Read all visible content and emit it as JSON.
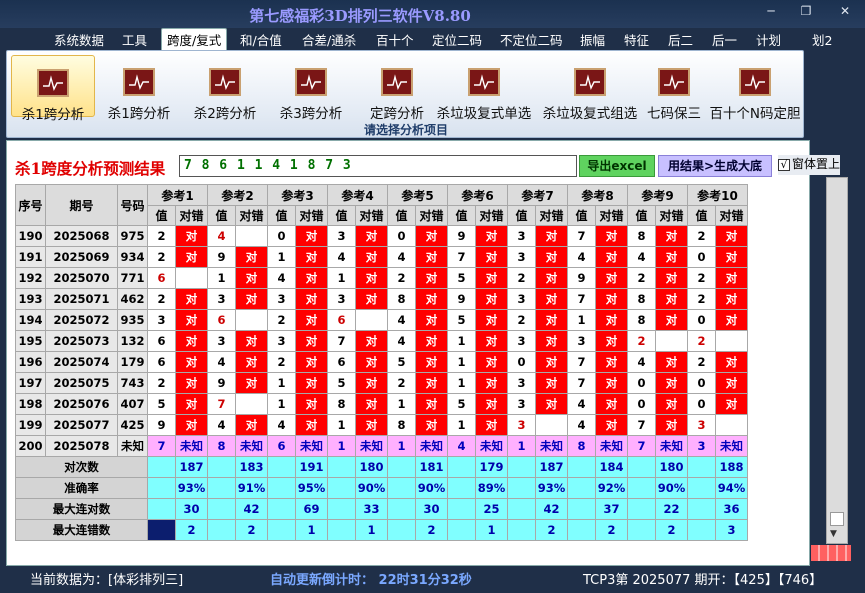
{
  "app_title": "第七感福彩3D排列三软件V8.80",
  "window_buttons": {
    "minimize": "─",
    "restore": "❐",
    "close": "✕"
  },
  "menu": [
    "系统数据",
    "工具",
    "跨度/复式",
    "和/合值",
    "合差/通杀",
    "百十个",
    "定位二码",
    "不定位二码",
    "振幅",
    "特征",
    "后二",
    "后一",
    "计划",
    "划2"
  ],
  "ribbon": {
    "items": [
      "杀1跨分析",
      "杀1跨分析",
      "杀2跨分析",
      "杀3跨分析",
      "定跨分析",
      "杀垃圾复式单选",
      "杀垃圾复式组选",
      "七码保三",
      "百十个N码定胆"
    ],
    "group_caption": "请选择分析项目"
  },
  "result": {
    "title": "杀1跨度分析预测结果",
    "digits": "7 8 6 1 1 4 1 8 7 3",
    "export_button": "导出excel",
    "generate_button": "用结果>生成大底",
    "topmost_check": "√",
    "topmost_label": "窗体置上"
  },
  "table": {
    "col_headers": [
      "序号",
      "期号",
      "号码"
    ],
    "refs": [
      "参考1",
      "参考2",
      "参考3",
      "参考4",
      "参考5",
      "参考6",
      "参考7",
      "参考8",
      "参考9",
      "参考10"
    ],
    "sub_headers": [
      "值",
      "对错"
    ],
    "rows": [
      {
        "seq": "190",
        "issue": "2025068",
        "num": "975",
        "vals": [
          "2",
          "4",
          "0",
          "3",
          "0",
          "9",
          "3",
          "7",
          "8",
          "2"
        ],
        "marks": [
          "对",
          "",
          "对",
          "对",
          "对",
          "对",
          "对",
          "对",
          "对",
          "对"
        ]
      },
      {
        "seq": "191",
        "issue": "2025069",
        "num": "934",
        "vals": [
          "2",
          "9",
          "1",
          "4",
          "4",
          "7",
          "3",
          "4",
          "4",
          "0"
        ],
        "marks": [
          "对",
          "对",
          "对",
          "对",
          "对",
          "对",
          "对",
          "对",
          "对",
          "对"
        ]
      },
      {
        "seq": "192",
        "issue": "2025070",
        "num": "771",
        "vals": [
          "6",
          "1",
          "4",
          "1",
          "2",
          "5",
          "2",
          "9",
          "2",
          "2"
        ],
        "marks": [
          "",
          "对",
          "对",
          "对",
          "对",
          "对",
          "对",
          "对",
          "对",
          "对"
        ]
      },
      {
        "seq": "193",
        "issue": "2025071",
        "num": "462",
        "vals": [
          "2",
          "3",
          "3",
          "3",
          "8",
          "9",
          "3",
          "7",
          "8",
          "2"
        ],
        "marks": [
          "对",
          "对",
          "对",
          "对",
          "对",
          "对",
          "对",
          "对",
          "对",
          "对"
        ]
      },
      {
        "seq": "194",
        "issue": "2025072",
        "num": "935",
        "vals": [
          "3",
          "6",
          "2",
          "6",
          "4",
          "5",
          "2",
          "1",
          "8",
          "0"
        ],
        "marks": [
          "对",
          "",
          "对",
          "",
          "对",
          "对",
          "对",
          "对",
          "对",
          "对"
        ]
      },
      {
        "seq": "195",
        "issue": "2025073",
        "num": "132",
        "vals": [
          "6",
          "3",
          "3",
          "7",
          "4",
          "1",
          "3",
          "3",
          "2",
          "2"
        ],
        "marks": [
          "对",
          "对",
          "对",
          "对",
          "对",
          "对",
          "对",
          "对",
          "",
          ""
        ]
      },
      {
        "seq": "196",
        "issue": "2025074",
        "num": "179",
        "vals": [
          "6",
          "4",
          "2",
          "6",
          "5",
          "1",
          "0",
          "7",
          "4",
          "2"
        ],
        "marks": [
          "对",
          "对",
          "对",
          "对",
          "对",
          "对",
          "对",
          "对",
          "对",
          "对"
        ]
      },
      {
        "seq": "197",
        "issue": "2025075",
        "num": "743",
        "vals": [
          "2",
          "9",
          "1",
          "5",
          "2",
          "1",
          "3",
          "7",
          "0",
          "0"
        ],
        "marks": [
          "对",
          "对",
          "对",
          "对",
          "对",
          "对",
          "对",
          "对",
          "对",
          "对"
        ]
      },
      {
        "seq": "198",
        "issue": "2025076",
        "num": "407",
        "vals": [
          "5",
          "7",
          "1",
          "8",
          "1",
          "5",
          "3",
          "4",
          "0",
          "0"
        ],
        "marks": [
          "对",
          "",
          "对",
          "对",
          "对",
          "对",
          "对",
          "对",
          "对",
          "对"
        ]
      },
      {
        "seq": "199",
        "issue": "2025077",
        "num": "425",
        "vals": [
          "9",
          "4",
          "4",
          "1",
          "8",
          "1",
          "3",
          "4",
          "7",
          "3"
        ],
        "marks": [
          "对",
          "对",
          "对",
          "对",
          "对",
          "对",
          "",
          "对",
          "对",
          ""
        ]
      },
      {
        "seq": "200",
        "issue": "2025078",
        "num": "未知",
        "vals": [
          "7",
          "8",
          "6",
          "1",
          "1",
          "4",
          "1",
          "8",
          "7",
          "3"
        ],
        "marks": [
          "未知",
          "未知",
          "未知",
          "未知",
          "未知",
          "未知",
          "未知",
          "未知",
          "未知",
          "未知"
        ]
      }
    ],
    "red_values": [
      [
        0,
        1
      ],
      [
        2,
        0
      ],
      [
        4,
        1
      ],
      [
        4,
        3
      ],
      [
        5,
        8
      ],
      [
        5,
        9
      ],
      [
        8,
        1
      ],
      [
        9,
        6
      ],
      [
        9,
        9
      ]
    ],
    "stats": [
      {
        "label": "对次数",
        "values": [
          "187",
          "183",
          "191",
          "180",
          "181",
          "179",
          "187",
          "184",
          "180",
          "188"
        ]
      },
      {
        "label": "准确率",
        "values": [
          "93%",
          "91%",
          "95%",
          "90%",
          "90%",
          "89%",
          "93%",
          "92%",
          "90%",
          "94%"
        ]
      },
      {
        "label": "最大连对数",
        "values": [
          "30",
          "42",
          "69",
          "33",
          "30",
          "25",
          "42",
          "37",
          "22",
          "36"
        ]
      },
      {
        "label": "最大连错数",
        "values": [
          "2",
          "2",
          "1",
          "1",
          "2",
          "1",
          "2",
          "2",
          "2",
          "3"
        ]
      }
    ]
  },
  "status": {
    "current_label": "当前数据为：[体彩排列三]",
    "countdown": "自动更新倒计时： 22时31分32秒",
    "period_info": "TCP3第 2025077 期开：【425】【746】"
  },
  "colors": {
    "red": "#ff0000",
    "cyan": "#80ffff",
    "pink": "#ffb0ff",
    "navy": "#0c1e6e",
    "green_btn": "#5fd35f",
    "purple_btn": "#c8c0ff"
  }
}
